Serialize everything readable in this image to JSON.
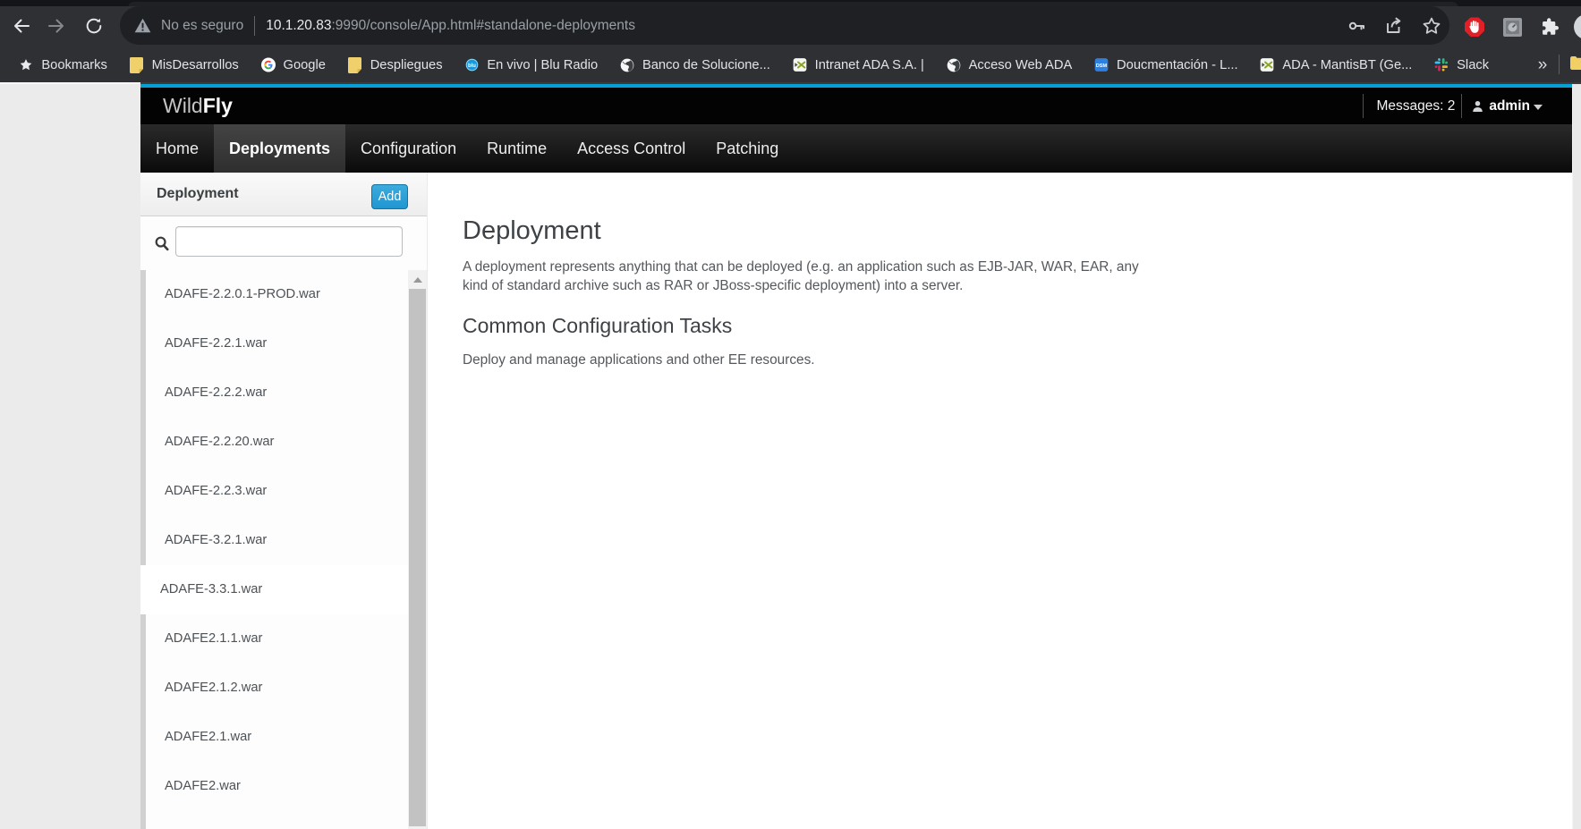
{
  "browser": {
    "toolbar": {
      "back_icon": "back-arrow",
      "forward_icon": "forward-arrow",
      "reload_icon": "reload"
    },
    "omnibox": {
      "security_warning": "No es seguro",
      "url_host": "10.1.20.83",
      "url_rest": ":9990/console/App.html#standalone-deployments",
      "key_icon": "key",
      "share_icon": "share",
      "star_icon": "bookmark-star"
    },
    "extensions": [
      "adblock",
      "extension",
      "puzzle"
    ],
    "bookmarks_bar": {
      "items": [
        {
          "label": "Bookmarks",
          "icon": "star"
        },
        {
          "label": "MisDesarrollos",
          "icon": "folder"
        },
        {
          "label": "Google",
          "icon": "google"
        },
        {
          "label": "Despliegues",
          "icon": "folder"
        },
        {
          "label": "En vivo | Blu Radio",
          "icon": "blu"
        },
        {
          "label": "Banco de Solucione...",
          "icon": "globe"
        },
        {
          "label": "Intranet ADA S.A. |",
          "icon": "xgreen"
        },
        {
          "label": "Acceso Web ADA",
          "icon": "globe"
        },
        {
          "label": "Doucmentación - L...",
          "icon": "dsm"
        },
        {
          "label": "ADA - MantisBT (Ge...",
          "icon": "xgreen"
        },
        {
          "label": "Slack",
          "icon": "slack"
        }
      ],
      "overflow_chevron": "»"
    }
  },
  "app": {
    "logo": {
      "part1": "Wild",
      "part2": "Fly"
    },
    "header": {
      "messages": "Messages: 2",
      "user": "admin"
    },
    "nav_tabs": [
      {
        "label": "Home",
        "active": false
      },
      {
        "label": "Deployments",
        "active": true
      },
      {
        "label": "Configuration",
        "active": false
      },
      {
        "label": "Runtime",
        "active": false
      },
      {
        "label": "Access Control",
        "active": false
      },
      {
        "label": "Patching",
        "active": false
      }
    ],
    "sidebar": {
      "title": "Deployment",
      "add_button": "Add",
      "search_value": "",
      "items": [
        {
          "label": "ADAFE-2.2.0.1-PROD.war",
          "active": false
        },
        {
          "label": "ADAFE-2.2.1.war",
          "active": false
        },
        {
          "label": "ADAFE-2.2.2.war",
          "active": false
        },
        {
          "label": "ADAFE-2.2.20.war",
          "active": false
        },
        {
          "label": "ADAFE-2.2.3.war",
          "active": false
        },
        {
          "label": "ADAFE-3.2.1.war",
          "active": false
        },
        {
          "label": "ADAFE-3.3.1.war",
          "active": true
        },
        {
          "label": "ADAFE2.1.1.war",
          "active": false
        },
        {
          "label": "ADAFE2.1.2.war",
          "active": false
        },
        {
          "label": "ADAFE2.1.war",
          "active": false
        },
        {
          "label": "ADAFE2.war",
          "active": false
        }
      ]
    },
    "main": {
      "title": "Deployment",
      "description": "A deployment represents anything that can be deployed (e.g. an application such as EJB-JAR, WAR, EAR, any kind of standard archive such as RAR or JBoss-specific deployment) into a server.",
      "section_title": "Common Configuration Tasks",
      "section_description": "Deploy and manage applications and other EE resources."
    }
  },
  "colors": {
    "accent": "#05a0d8",
    "add_button_blue": "#2b9fd6",
    "navbar_black": "#0a0a0a",
    "chrome_dark": "#2e3033"
  }
}
